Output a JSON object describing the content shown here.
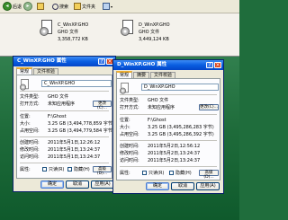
{
  "explorer": {
    "back_label": "后退",
    "search_label": "搜索",
    "folders_label": "文件夹",
    "files": [
      {
        "name": "C_WinXP.GHO",
        "type": "GHO 文件",
        "size": "3,358,772 KB"
      },
      {
        "name": "D_WinXP.GHO",
        "type": "GHO 文件",
        "size": "3,449,124 KB"
      }
    ]
  },
  "dialogs": [
    {
      "title": "C_WinXP.GHO 属性",
      "tabs": [
        "常规",
        "文件校验"
      ],
      "filename": "C_WinXP.GHO",
      "rows": [
        {
          "label": "文件类型:",
          "value": "GHO 文件"
        },
        {
          "label": "打开方式:",
          "value": "未知应用程序"
        },
        {
          "label": "位置:",
          "value": "F:\\Ghost"
        },
        {
          "label": "大小:",
          "value": "3.25 GB (3,494,778,859 字节)"
        },
        {
          "label": "占用空间:",
          "value": "3.25 GB (3,494,779,584 字节)"
        },
        {
          "label": "创建时间:",
          "value": "2011年5月1日,12:26:12"
        },
        {
          "label": "修改时间:",
          "value": "2011年5月1日,13:24:37"
        },
        {
          "label": "访问时间:",
          "value": "2011年5月1日,13:24:37"
        }
      ],
      "change_label": "更改(C)...",
      "attr_label": "属性:",
      "readonly_label": "只读(R)",
      "hidden_label": "隐藏(H)",
      "advanced_label": "高级(D)...",
      "buttons": {
        "ok": "确定",
        "cancel": "取消",
        "apply": "应用(A)"
      }
    },
    {
      "title": "D_WinXP.GHO 属性",
      "tabs": [
        "常规",
        "摘要",
        "文件校验"
      ],
      "filename": "D_WinXP.GHO",
      "rows": [
        {
          "label": "文件类型:",
          "value": "GHO 文件"
        },
        {
          "label": "打开方式:",
          "value": "未知应用程序"
        },
        {
          "label": "位置:",
          "value": "F:\\Ghost"
        },
        {
          "label": "大小:",
          "value": "3.25 GB (3,495,286,283 字节)"
        },
        {
          "label": "占用空间:",
          "value": "3.25 GB (3,495,286,392 字节)"
        },
        {
          "label": "创建时间:",
          "value": "2011年5月2日,12:56:12"
        },
        {
          "label": "修改时间:",
          "value": "2011年5月2日,13:24:37"
        },
        {
          "label": "访问时间:",
          "value": "2011年5月2日,13:24:37"
        }
      ],
      "change_label": "更改(C)...",
      "attr_label": "属性:",
      "readonly_label": "只读(R)",
      "hidden_label": "隐藏(H)",
      "advanced_label": "高级(D)...",
      "buttons": {
        "ok": "确定",
        "cancel": "取消",
        "apply": "应用(A)"
      }
    }
  ],
  "colors": {
    "titlebar": "#0a5ee0",
    "desktop": "#1f6d3c",
    "dialog_bg": "#ece9d8"
  }
}
